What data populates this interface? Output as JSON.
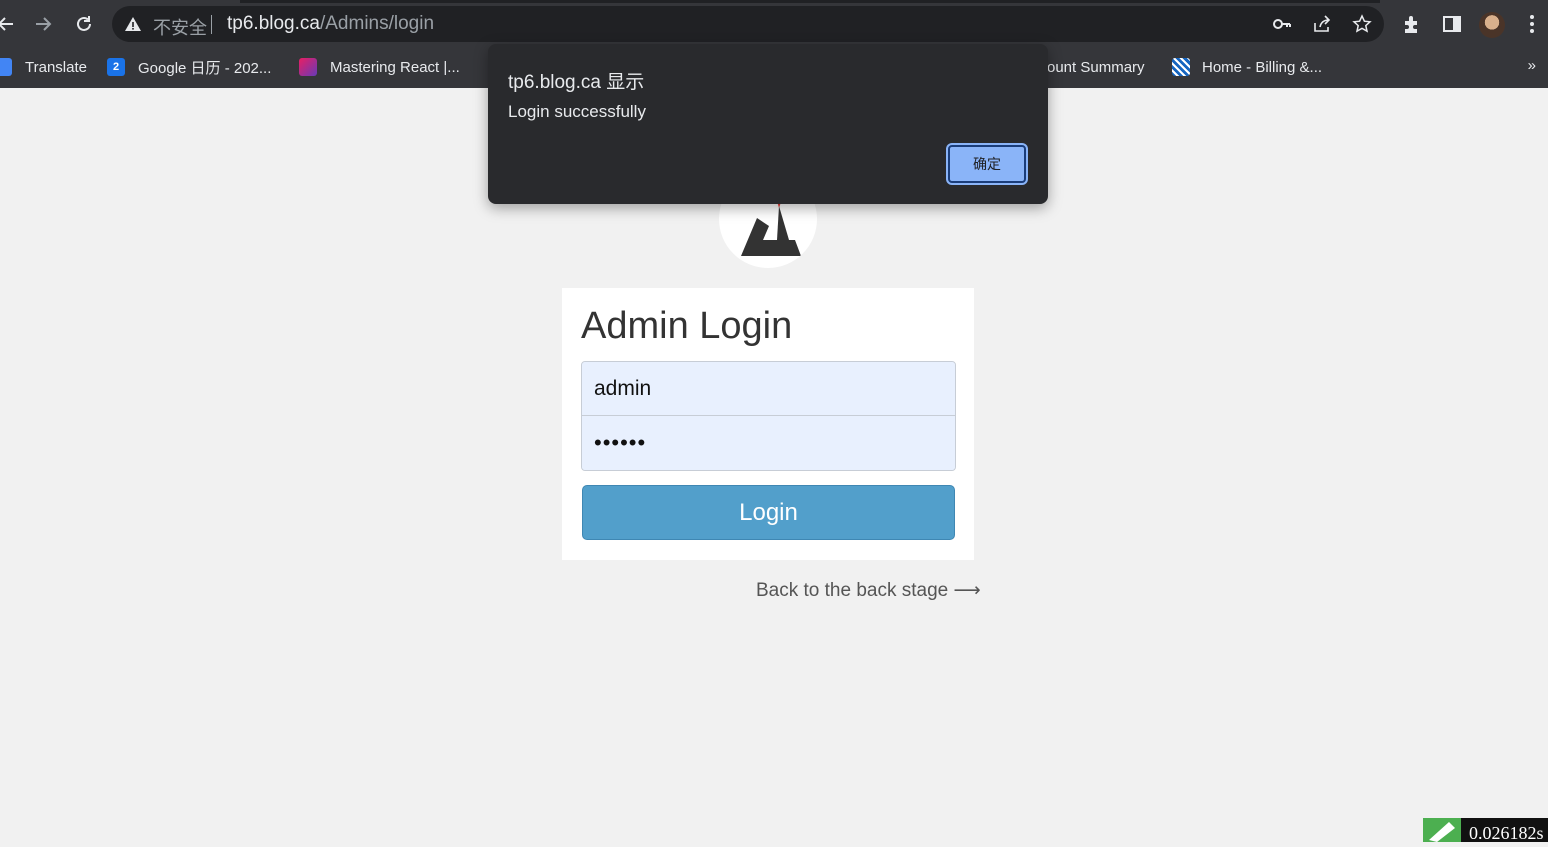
{
  "browser": {
    "insecure_label": "不安全",
    "url_host": "tp6.blog.ca",
    "url_path": "/Admins/login",
    "bookmarks": [
      {
        "label": "Translate"
      },
      {
        "label": "Google 日历 - 202..."
      },
      {
        "label": "Mastering React |..."
      },
      {
        "label": "ount Summary"
      },
      {
        "label": "Home - Billing &..."
      }
    ],
    "bookmarks_more": "»"
  },
  "dialog": {
    "title": "tp6.blog.ca 显示",
    "message": "Login successfully",
    "ok_label": "确定"
  },
  "login": {
    "title": "Admin Login",
    "username_value": "admin",
    "password_value": "••••••",
    "submit_label": "Login",
    "back_link": "Back to the back stage ⟶"
  },
  "corner_widget": {
    "value": "0.026182s"
  },
  "colors": {
    "chrome_bg": "#35363a",
    "page_bg": "#f1f1f1",
    "button_blue": "#529fcb",
    "autofill_bg": "#e8f0fe",
    "dialog_bg": "#292a2d",
    "dialog_ok_bg": "#8ab4f8"
  }
}
